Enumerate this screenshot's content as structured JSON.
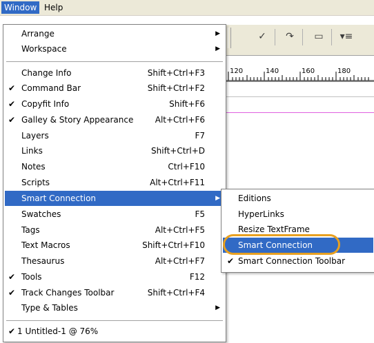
{
  "menubar": {
    "items": [
      {
        "label": "Window",
        "active": true
      },
      {
        "label": "Help",
        "active": false
      }
    ]
  },
  "toolbar": {
    "icons": [
      "checkmark-icon",
      "redo-icon",
      "comment-icon",
      "dropdown-list-icon"
    ]
  },
  "ruler": {
    "labels": [
      "120",
      "140",
      "160",
      "180"
    ]
  },
  "menu": {
    "items": [
      {
        "label": "Arrange",
        "shortcut": "",
        "submenu": true,
        "checked": false
      },
      {
        "label": "Workspace",
        "shortcut": "",
        "submenu": true,
        "checked": false
      },
      {
        "label": "Change Info",
        "shortcut": "Shift+Ctrl+F3",
        "submenu": false,
        "checked": false
      },
      {
        "label": "Command Bar",
        "shortcut": "Shift+Ctrl+F2",
        "submenu": false,
        "checked": true
      },
      {
        "label": "Copyfit Info",
        "shortcut": "Shift+F6",
        "submenu": false,
        "checked": true
      },
      {
        "label": "Galley & Story Appearance",
        "shortcut": "Alt+Ctrl+F6",
        "submenu": false,
        "checked": true
      },
      {
        "label": "Layers",
        "shortcut": "F7",
        "submenu": false,
        "checked": false
      },
      {
        "label": "Links",
        "shortcut": "Shift+Ctrl+D",
        "submenu": false,
        "checked": false
      },
      {
        "label": "Notes",
        "shortcut": "Ctrl+F10",
        "submenu": false,
        "checked": false
      },
      {
        "label": "Scripts",
        "shortcut": "Alt+Ctrl+F11",
        "submenu": false,
        "checked": false
      },
      {
        "label": "Smart Connection",
        "shortcut": "",
        "submenu": true,
        "checked": false,
        "highlighted": true
      },
      {
        "label": "Swatches",
        "shortcut": "F5",
        "submenu": false,
        "checked": false
      },
      {
        "label": "Tags",
        "shortcut": "Alt+Ctrl+F5",
        "submenu": false,
        "checked": false
      },
      {
        "label": "Text Macros",
        "shortcut": "Shift+Ctrl+F10",
        "submenu": false,
        "checked": false
      },
      {
        "label": "Thesaurus",
        "shortcut": "Alt+Ctrl+F7",
        "submenu": false,
        "checked": false
      },
      {
        "label": "Tools",
        "shortcut": "F12",
        "submenu": false,
        "checked": true
      },
      {
        "label": "Track Changes Toolbar",
        "shortcut": "Shift+Ctrl+F4",
        "submenu": false,
        "checked": true
      },
      {
        "label": "Type & Tables",
        "shortcut": "",
        "submenu": true,
        "checked": false
      },
      {
        "label": "1 Untitled-1 @ 76%",
        "shortcut": "",
        "submenu": false,
        "checked": true
      }
    ]
  },
  "submenu": {
    "items": [
      {
        "label": "Editions",
        "checked": false
      },
      {
        "label": "HyperLinks",
        "checked": false
      },
      {
        "label": "Resize TextFrame",
        "checked": false
      },
      {
        "label": "Smart Connection",
        "checked": false,
        "highlighted": true
      },
      {
        "label": "Smart Connection Toolbar",
        "checked": true
      }
    ]
  },
  "colors": {
    "highlight": "#316ac5",
    "annotation_ring": "#e8a020",
    "guide_line": "#e060e0"
  }
}
